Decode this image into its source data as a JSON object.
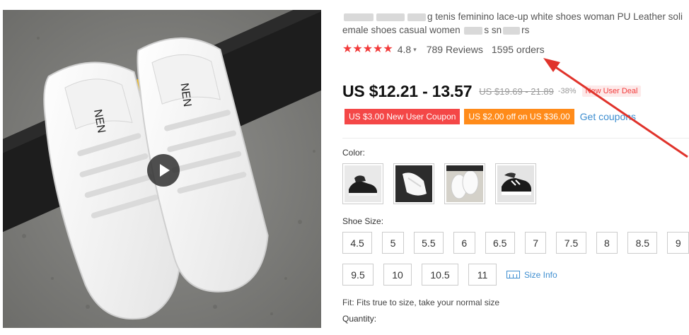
{
  "product": {
    "title_line1_visible": "g tenis feminino lace-up white shoes woman PU Leather soli",
    "title_line2_part1": "emale shoes casual women",
    "title_line2_part2": "s sn",
    "title_line2_part3": "rs"
  },
  "rating": {
    "stars": "★★★★★",
    "value": "4.8",
    "caret": "▾",
    "reviews": "789 Reviews",
    "orders": "1595 orders"
  },
  "price": {
    "current": "US $12.21 - 13.57",
    "original": "US $19.69 - 21.89",
    "discount": "-38%",
    "deal": "New User Deal"
  },
  "coupons": {
    "coupon1": "US $3.00 New User Coupon",
    "coupon2": "US $2.00 off on US $36.00",
    "get_link": "Get coupons"
  },
  "color": {
    "label": "Color:",
    "options": [
      "black sneaker",
      "white sneaker on black",
      "white sneaker pair",
      "black sneaker white laces"
    ]
  },
  "size": {
    "label": "Shoe Size:",
    "row1": [
      "4.5",
      "5",
      "5.5",
      "6",
      "6.5",
      "7",
      "7.5",
      "8",
      "8.5",
      "9"
    ],
    "row2": [
      "9.5",
      "10",
      "10.5",
      "11"
    ],
    "info": "Size Info"
  },
  "fit": "Fit: Fits true to size, take your normal size",
  "quantity_label": "Quantity:",
  "colors": {
    "star": "#f23a3a",
    "link": "#3e8ed0",
    "coupon_red": "#f44747",
    "coupon_orange": "#ff8b1a",
    "arrow": "#e0332b"
  }
}
